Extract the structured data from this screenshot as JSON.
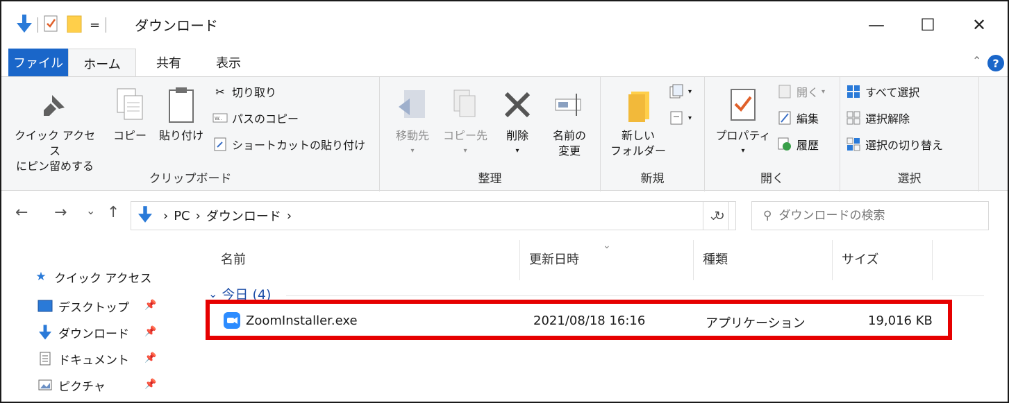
{
  "window": {
    "title": "ダウンロード",
    "qa_dropdown": "=",
    "minimize": "—",
    "maximize": "☐",
    "close": "✕"
  },
  "tabs": {
    "file": "ファイル",
    "home": "ホーム",
    "share": "共有",
    "view": "表示",
    "help": "?"
  },
  "ribbon": {
    "clipboard": {
      "label": "クリップボード",
      "pin_line1": "クイック アクセス",
      "pin_line2": "にピン留めする",
      "copy": "コピー",
      "paste": "貼り付け",
      "cut": "切り取り",
      "copy_path": "パスのコピー",
      "paste_shortcut": "ショートカットの貼り付け"
    },
    "organize": {
      "label": "整理",
      "move_to": "移動先",
      "copy_to": "コピー先",
      "delete": "削除",
      "rename_line1": "名前の",
      "rename_line2": "変更"
    },
    "new": {
      "label": "新規",
      "new_folder_line1": "新しい",
      "new_folder_line2": "フォルダー"
    },
    "open": {
      "label": "開く",
      "properties": "プロパティ",
      "open": "開く",
      "edit": "編集",
      "history": "履歴"
    },
    "select": {
      "label": "選択",
      "select_all": "すべて選択",
      "select_none": "選択解除",
      "invert": "選択の切り替え"
    }
  },
  "address": {
    "back": "←",
    "forward": "→",
    "recent": "⌄",
    "up": "↑",
    "crumb_pc": "PC",
    "crumb_downloads": "ダウンロード",
    "sep": "›",
    "dropdown": "⌄",
    "refresh": "↻",
    "search_placeholder": "ダウンロードの検索"
  },
  "navpane": {
    "quick_access": "クイック アクセス",
    "desktop": "デスクトップ",
    "downloads": "ダウンロード",
    "documents": "ドキュメント",
    "pictures": "ピクチャ"
  },
  "columns": {
    "name": "名前",
    "modified": "更新日時",
    "type": "種類",
    "size": "サイズ"
  },
  "group": {
    "label": "今日 (4)"
  },
  "files": [
    {
      "name": "ZoomInstaller.exe",
      "modified": "2021/08/18 16:16",
      "type": "アプリケーション",
      "size": "19,016 KB"
    }
  ],
  "colors": {
    "accent": "#1a66c9",
    "highlight": "#e60000",
    "zoom": "#2d8cff"
  }
}
